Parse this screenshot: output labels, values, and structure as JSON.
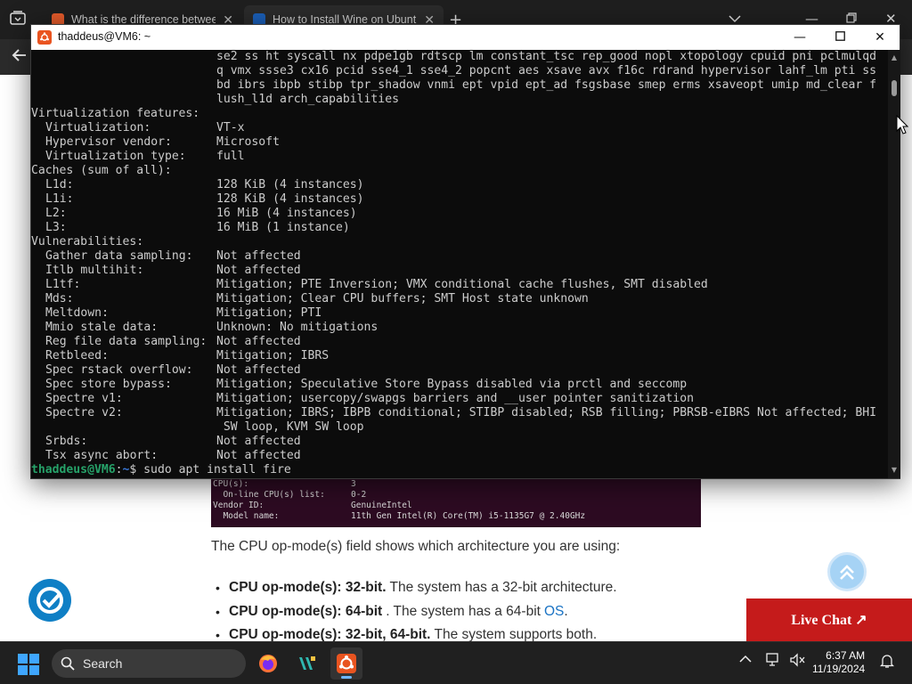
{
  "browser": {
    "tabs": [
      {
        "title": "What is the difference between",
        "favicon_color": "#e45b2b"
      },
      {
        "title": "How to Install Wine on Ubuntu",
        "favicon_color": "#1b5fb8"
      }
    ]
  },
  "webpage": {
    "code_image_rows": [
      {
        "k": "CPU(s):",
        "v": "3"
      },
      {
        "k": "  On-line CPU(s) list:",
        "v": "0-2"
      },
      {
        "k": "Vendor ID:",
        "v": "GenuineIntel"
      },
      {
        "k": "  Model name:",
        "v": "11th Gen Intel(R) Core(TM) i5-1135G7 @ 2.40GHz"
      }
    ],
    "paragraph": "The CPU op-mode(s) field shows which architecture you are using:",
    "bullets": [
      {
        "bold": "CPU op-mode(s): 32-bit.",
        "text": "The system has a 32-bit architecture.",
        "link": ""
      },
      {
        "bold": "CPU op-mode(s): 64-bit",
        "text": ". The system has a 64-bit",
        "link": "OS",
        "after": "."
      },
      {
        "bold": "CPU op-mode(s): 32-bit, 64-bit.",
        "text": "The system supports both.",
        "link": ""
      }
    ],
    "live_chat": "Live Chat ↗"
  },
  "terminal": {
    "title": "thaddeus@VM6: ~",
    "flags_lines": [
      "se2 ss ht syscall nx pdpe1gb rdtscp lm constant_tsc rep_good nopl xtopology cpuid pni pclmulqd",
      "q vmx ssse3 cx16 pcid sse4_1 sse4_2 popcnt aes xsave avx f16c rdrand hypervisor lahf_lm pti ss",
      "bd ibrs ibpb stibp tpr_shadow vnmi ept vpid ept_ad fsgsbase smep erms xsaveopt umip md_clear f",
      "lush_l1d arch_capabilities"
    ],
    "virtualization": {
      "header": "Virtualization features:",
      "rows": [
        {
          "k": "Virtualization:",
          "v": "VT-x"
        },
        {
          "k": "Hypervisor vendor:",
          "v": "Microsoft"
        },
        {
          "k": "Virtualization type:",
          "v": "full"
        }
      ]
    },
    "caches": {
      "header": "Caches (sum of all):",
      "rows": [
        {
          "k": "L1d:",
          "v": "128 KiB (4 instances)"
        },
        {
          "k": "L1i:",
          "v": "128 KiB (4 instances)"
        },
        {
          "k": "L2:",
          "v": "16 MiB (4 instances)"
        },
        {
          "k": "L3:",
          "v": "16 MiB (1 instance)"
        }
      ]
    },
    "vulnerabilities": {
      "header": "Vulnerabilities:",
      "rows": [
        {
          "k": "Gather data sampling:",
          "v": "Not affected"
        },
        {
          "k": "Itlb multihit:",
          "v": "Not affected"
        },
        {
          "k": "L1tf:",
          "v": "Mitigation; PTE Inversion; VMX conditional cache flushes, SMT disabled"
        },
        {
          "k": "Mds:",
          "v": "Mitigation; Clear CPU buffers; SMT Host state unknown"
        },
        {
          "k": "Meltdown:",
          "v": "Mitigation; PTI"
        },
        {
          "k": "Mmio stale data:",
          "v": "Unknown: No mitigations"
        },
        {
          "k": "Reg file data sampling:",
          "v": "Not affected"
        },
        {
          "k": "Retbleed:",
          "v": "Mitigation; IBRS"
        },
        {
          "k": "Spec rstack overflow:",
          "v": "Not affected"
        },
        {
          "k": "Spec store bypass:",
          "v": "Mitigation; Speculative Store Bypass disabled via prctl and seccomp"
        },
        {
          "k": "Spectre v1:",
          "v": "Mitigation; usercopy/swapgs barriers and __user pointer sanitization"
        },
        {
          "k": "Spectre v2:",
          "v": "Mitigation; IBRS; IBPB conditional; STIBP disabled; RSB filling; PBRSB-eIBRS Not affected; BHI"
        },
        {
          "k": "",
          "v": " SW loop, KVM SW loop",
          "continuation": true
        },
        {
          "k": "Srbds:",
          "v": "Not affected"
        },
        {
          "k": "Tsx async abort:",
          "v": "Not affected"
        }
      ]
    },
    "prompt": {
      "user_host": "thaddeus@VM6",
      "sep": ":",
      "path": "~",
      "symbol": "$ ",
      "command": "sudo apt install fire"
    }
  },
  "taskbar": {
    "search_placeholder": "Search",
    "time": "6:37 AM",
    "date": "11/19/2024"
  },
  "colors": {
    "terminal_bg": "#0c0c0c",
    "terminal_fg": "#cccccc",
    "prompt_user": "#26a269",
    "prompt_path": "#3a78d8",
    "live_chat_bg": "#c51b1b",
    "link": "#1a73c4"
  },
  "icons": {
    "tab_list": "tab-list-icon",
    "back": "arrow-left-icon",
    "terminal_app": "ubuntu-terminal-icon",
    "start": "windows-logo-icon",
    "firefox": "firefox-icon",
    "vscode": "code-editor-icon",
    "ubuntu": "ubuntu-icon"
  }
}
